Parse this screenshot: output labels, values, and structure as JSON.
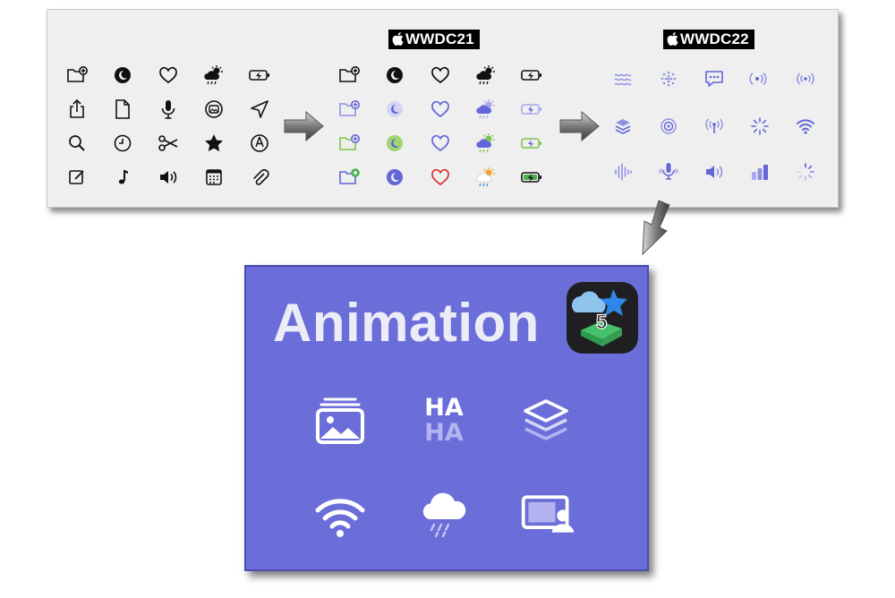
{
  "badges": {
    "wwdc21": "WWDC21",
    "wwdc22": "WWDC22"
  },
  "colors": {
    "panel_bg": "#efefef",
    "accent_purple": "#6b6ed9",
    "icon_black": "#111111",
    "icon_purple": "#6366d8",
    "icon_green": "#7ec44a",
    "icon_red": "#d93333",
    "icon_orange": "#f2a227",
    "white": "#ffffff"
  },
  "grid_left": {
    "rows": [
      [
        "folder-badge-plus-icon",
        "moon-circle-icon",
        "heart-icon",
        "cloud-sun-rain-icon",
        "battery-bolt-icon"
      ],
      [
        "share-icon",
        "doc-icon",
        "mic-icon",
        "photo-circle-icon",
        "location-arrow-icon"
      ],
      [
        "magnifier-icon",
        "clock-icon",
        "scissors-icon",
        "star-icon",
        "pencil-circle-icon"
      ],
      [
        "square-pencil-icon",
        "music-note-icon",
        "speaker-wave-icon",
        "calendar-icon",
        "paperclip-icon"
      ]
    ]
  },
  "grid_wwdc21": {
    "columns": [
      "folder-badge-plus-icon",
      "moon-circle-icon",
      "heart-icon",
      "cloud-sun-rain-icon",
      "battery-bolt-icon"
    ],
    "rendering_modes": [
      "monochrome",
      "hierarchical",
      "palette",
      "multicolor"
    ]
  },
  "grid_wwdc22": {
    "rows": [
      [
        "water-waves-icon",
        "dots-circle-icon",
        "speech-bubble-icon",
        "dot-radiowaves-right-icon",
        "dot-radiowaves-both-icon"
      ],
      [
        "square-stack-3d-icon",
        "target-icon",
        "antenna-icon",
        "rays-icon",
        "wifi-icon"
      ],
      [
        "waveform-icon",
        "mic-waves-icon",
        "speaker-wave-icon",
        "chart-bars-icon",
        "progress-indicator-icon"
      ]
    ]
  },
  "animation_card": {
    "title": "Animation",
    "app_icon": "app-badge-5-icon",
    "app_icon_number": "5",
    "icons": [
      "photo-stack-icon",
      "haha-text-icon",
      "square-stack-3d-icon",
      "wifi-icon",
      "cloud-rain-icon",
      "shareplay-person-icon"
    ],
    "haha_text": "HA"
  }
}
